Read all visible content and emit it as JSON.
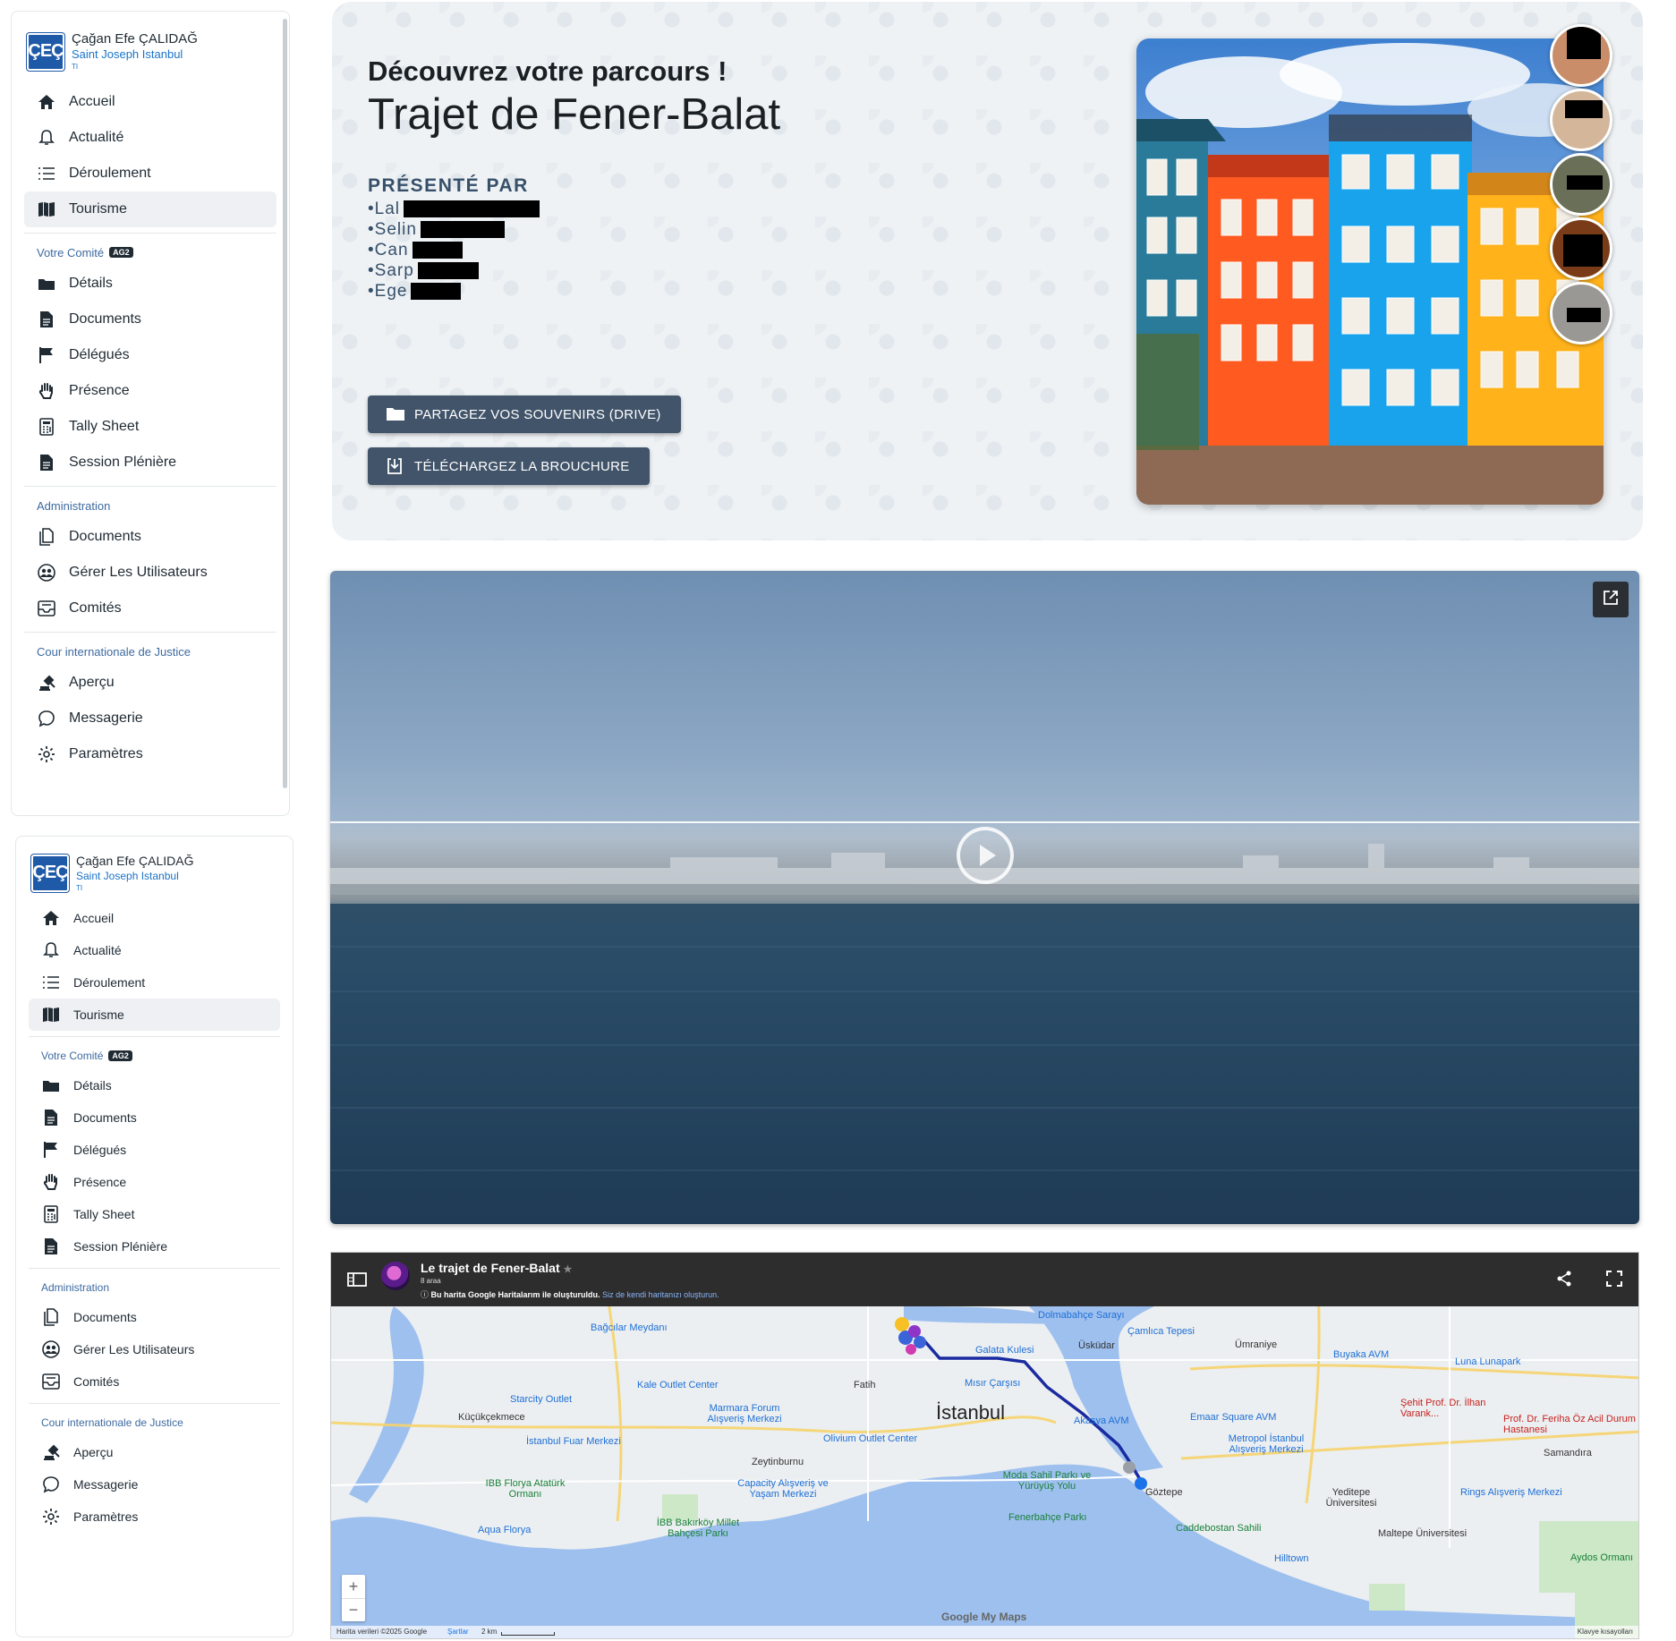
{
  "user": {
    "name": "Çağan Efe ÇALIDAĞ",
    "school": "Saint Joseph Istanbul",
    "role": "TI",
    "logo_text": "ÇEÇ"
  },
  "nav": {
    "main": [
      {
        "label": "Accueil",
        "icon": "home-icon"
      },
      {
        "label": "Actualité",
        "icon": "bell-icon"
      },
      {
        "label": "Déroulement",
        "icon": "list-icon"
      },
      {
        "label": "Tourisme",
        "icon": "map-icon",
        "active": true
      }
    ],
    "committee_title": "Votre Comité",
    "committee_badge": "AG2",
    "committee": [
      {
        "label": "Détails",
        "icon": "folder-icon"
      },
      {
        "label": "Documents",
        "icon": "document-icon"
      },
      {
        "label": "Délégués",
        "icon": "flag-icon"
      },
      {
        "label": "Présence",
        "icon": "hand-icon"
      },
      {
        "label": "Tally Sheet",
        "icon": "calculator-icon"
      },
      {
        "label": "Session Plénière",
        "icon": "document-icon"
      }
    ],
    "admin_title": "Administration",
    "admin": [
      {
        "label": "Documents",
        "icon": "files-icon"
      },
      {
        "label": "Gérer Les Utilisateurs",
        "icon": "users-icon"
      },
      {
        "label": "Comités",
        "icon": "inbox-icon"
      }
    ],
    "cij_title": "Cour internationale de Justice",
    "cij": [
      {
        "label": "Aperçu",
        "icon": "court-icon"
      },
      {
        "label": "Messagerie",
        "icon": "chat-icon"
      },
      {
        "label": "Paramètres",
        "icon": "settings-icon"
      }
    ]
  },
  "hero": {
    "subtitle": "Découvrez votre parcours !",
    "title": "Trajet de Fener-Balat",
    "presented_by": "PRÉSENTÉ PAR",
    "presenters": [
      "•Lal",
      "•Selin",
      "•Can",
      "•Sarp",
      "•Ege"
    ],
    "btn_drive": "PARTAGEZ VOS SOUVENIRS (DRIVE)",
    "btn_brochure": "TÉLÉCHARGEZ LA BROUCHURE"
  },
  "map": {
    "title": "Le trajet de Fener-Balat",
    "meta": "8 araa",
    "note_bold": "Bu harita Google Haritalarım ile oluşturuldu.",
    "note_link": "Siz de kendi haritanızı oluşturun.",
    "city": "İstanbul",
    "labels": [
      {
        "t": "Bağcılar Meydanı",
        "c": "poi"
      },
      {
        "t": "Dolmabahçe Sarayı",
        "c": "poi"
      },
      {
        "t": "Çamlıca Tepesi",
        "c": "poi"
      },
      {
        "t": "Galata Kulesi",
        "c": "poi"
      },
      {
        "t": "Üsküdar",
        "c": ""
      },
      {
        "t": "Ümraniye",
        "c": ""
      },
      {
        "t": "Buyaka AVM",
        "c": "poi"
      },
      {
        "t": "Luna Lunapark",
        "c": "poi"
      },
      {
        "t": "Starcity Outlet",
        "c": "poi"
      },
      {
        "t": "Kale Outlet Center",
        "c": "poi"
      },
      {
        "t": "Fatih",
        "c": ""
      },
      {
        "t": "Mısır Çarşısı",
        "c": "poi"
      },
      {
        "t": "Küçükçekmece",
        "c": ""
      },
      {
        "t": "Marmara Forum Alışveriş Merkezi",
        "c": "poi"
      },
      {
        "t": "Akasya AVM",
        "c": "poi"
      },
      {
        "t": "Emaar Square AVM",
        "c": "poi"
      },
      {
        "t": "Şehit Prof. Dr. İlhan Varank...",
        "c": "red"
      },
      {
        "t": "Prof. Dr. Feriha Öz Acil Durum Hastanesi",
        "c": "red"
      },
      {
        "t": "İstanbul Fuar Merkezi",
        "c": "poi"
      },
      {
        "t": "Olivium Outlet Center",
        "c": "poi"
      },
      {
        "t": "Metropol İstanbul Alışveriş Merkezi",
        "c": "poi"
      },
      {
        "t": "Samandıra",
        "c": ""
      },
      {
        "t": "Zeytinburnu",
        "c": ""
      },
      {
        "t": "IBB Florya Atatürk Ormanı",
        "c": "grn"
      },
      {
        "t": "Capacity Alışveriş ve Yaşam Merkezi",
        "c": "poi"
      },
      {
        "t": "Moda Sahil Parkı ve Yürüyüş Yolu",
        "c": "grn"
      },
      {
        "t": "Göztepe",
        "c": ""
      },
      {
        "t": "Yeditepe Üniversitesi",
        "c": ""
      },
      {
        "t": "Rings Alışveriş Merkezi",
        "c": "poi"
      },
      {
        "t": "Aqua Florya",
        "c": "poi"
      },
      {
        "t": "İBB Bakırköy Millet Bahçesi Parkı",
        "c": "grn"
      },
      {
        "t": "Fenerbahçe Parkı",
        "c": "grn"
      },
      {
        "t": "Caddebostan Sahili",
        "c": "grn"
      },
      {
        "t": "Maltepe Üniversitesi",
        "c": ""
      },
      {
        "t": "Hilltown",
        "c": "poi"
      },
      {
        "t": "Aydos Ormanı",
        "c": "grn"
      }
    ],
    "footer_data": "Harita verileri ©2025 Google",
    "footer_terms": "Şartlar",
    "footer_scale": "2 km",
    "footer_shortcuts": "Klavye kısayolları",
    "brand": "Google My Maps"
  }
}
